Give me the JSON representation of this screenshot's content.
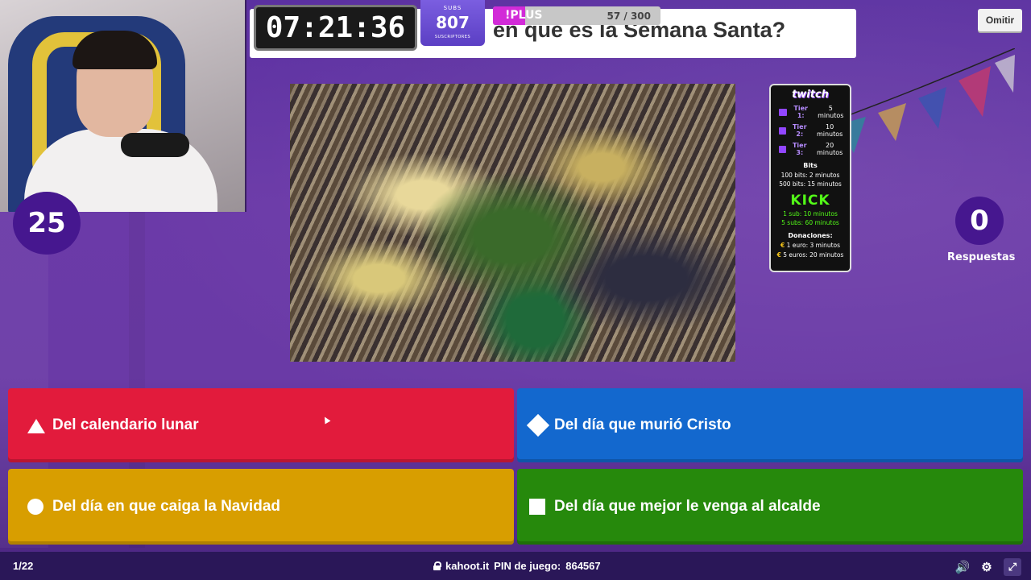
{
  "stream": {
    "timer": "07:21:36",
    "subs": {
      "top_label": "SUBS",
      "count": "807",
      "bottom_label": "SUSCRIPTORES"
    },
    "plus": {
      "label": "!PLUS",
      "count": "57 / 300",
      "progress_fraction": 0.19
    },
    "twitch_panel": {
      "logo": "twitch",
      "tiers": [
        {
          "name": "Tier 1:",
          "value": "5 minutos"
        },
        {
          "name": "Tier 2:",
          "value": "10 minutos"
        },
        {
          "name": "Tier 3:",
          "value": "20 minutos"
        }
      ],
      "bits_title": "Bits",
      "bits": [
        "100 bits: 2 minutos",
        "500 bits: 15 minutos"
      ],
      "kick_logo": "KICK",
      "kick": [
        "1 sub: 10 minutos",
        "5 subs: 60 minutos"
      ],
      "donations_title": "Donaciones:",
      "donations": [
        {
          "symbol": "€",
          "text": "1 euro: 3 minutos"
        },
        {
          "symbol": "€",
          "text": "5 euros: 20 minutos"
        }
      ]
    }
  },
  "quiz": {
    "question": "en que es la Semana Santa?",
    "skip_label": "Omitir",
    "countdown": "25",
    "answers_count": "0",
    "answers_label": "Respuestas",
    "options": [
      {
        "shape": "triangle-icon",
        "color": "#e21b3c",
        "label": "Del calendario lunar"
      },
      {
        "shape": "diamond-icon",
        "color": "#1368ce",
        "label": "Del día que murió Cristo"
      },
      {
        "shape": "circle-icon",
        "color": "#d89e00",
        "label": "Del día en que caiga la Navidad"
      },
      {
        "shape": "square-icon",
        "color": "#26890c",
        "label": "Del día que mejor le venga al alcalde"
      }
    ]
  },
  "footer": {
    "question_index": "1/22",
    "site": "kahoot.it",
    "pin_label": "PIN de juego:",
    "pin": "864567",
    "icons": [
      "volume-icon",
      "settings-icon",
      "exit-fullscreen-icon"
    ]
  }
}
